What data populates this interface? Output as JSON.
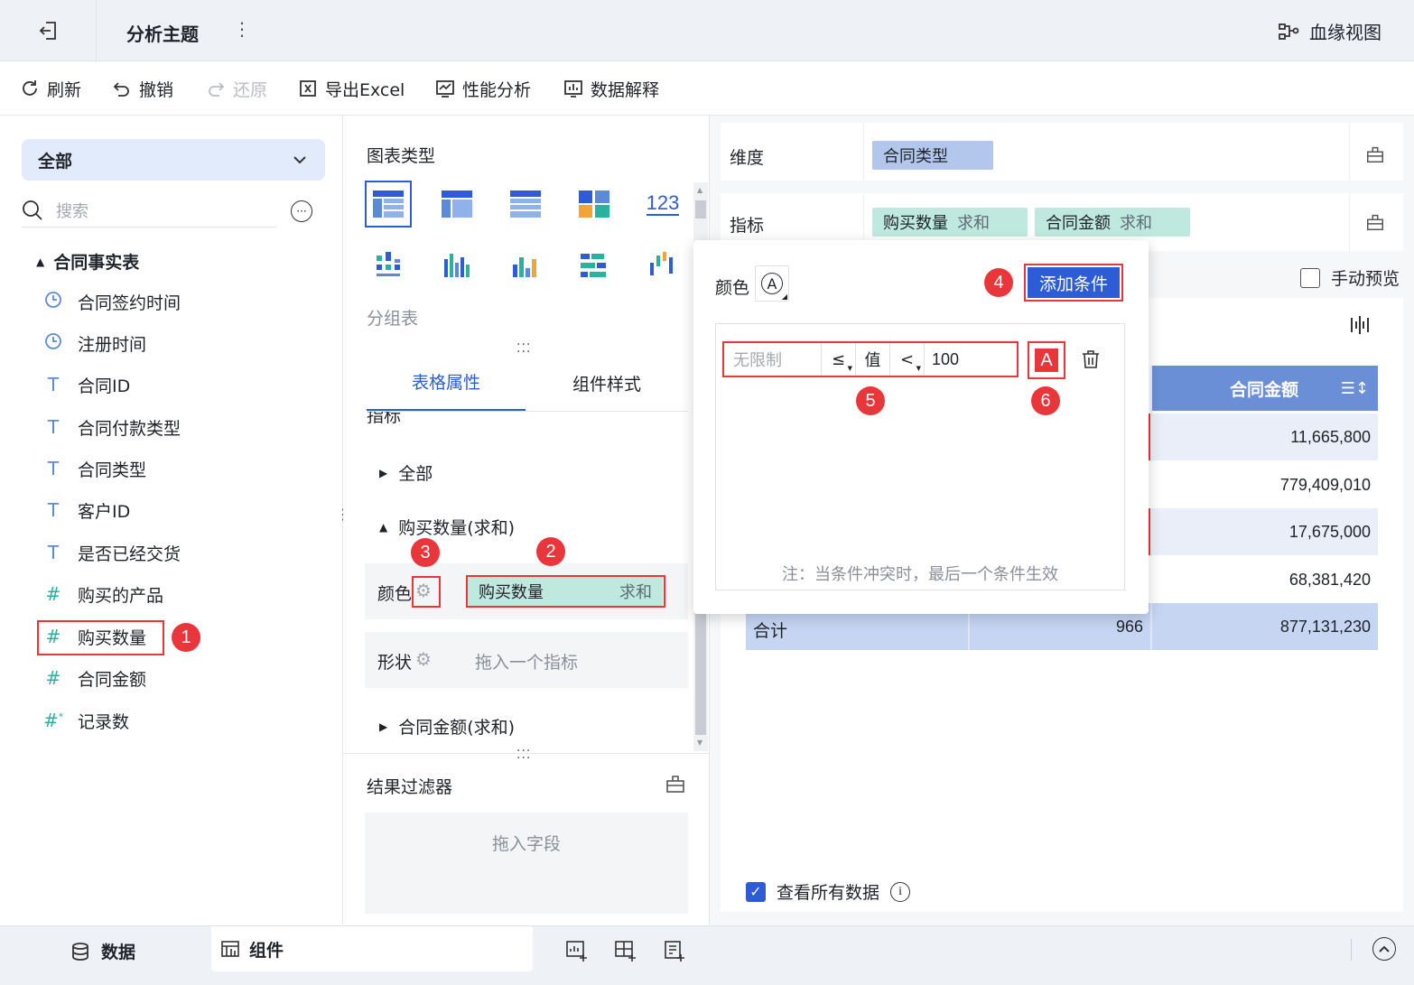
{
  "topbar": {
    "title": "分析主题",
    "lineage": "血缘视图"
  },
  "toolbar": {
    "refresh": "刷新",
    "undo": "撤销",
    "redo": "还原",
    "export": "导出Excel",
    "perf": "性能分析",
    "explain": "数据解释"
  },
  "left": {
    "scope": "全部",
    "search_placeholder": "搜索",
    "table_name": "合同事实表",
    "fields": [
      {
        "label": "合同签约时间",
        "icon": "clock-icon"
      },
      {
        "label": "注册时间",
        "icon": "clock-icon"
      },
      {
        "label": "合同ID",
        "icon": "text-icon"
      },
      {
        "label": "合同付款类型",
        "icon": "text-icon"
      },
      {
        "label": "合同类型",
        "icon": "text-icon"
      },
      {
        "label": "客户ID",
        "icon": "text-icon"
      },
      {
        "label": "是否已经交货",
        "icon": "text-icon"
      },
      {
        "label": "购买的产品",
        "icon": "number-icon"
      },
      {
        "label": "购买数量",
        "icon": "number-icon"
      },
      {
        "label": "合同金额",
        "icon": "number-icon"
      },
      {
        "label": "记录数",
        "icon": "count-icon"
      }
    ]
  },
  "mid": {
    "chart_type_label": "图表类型",
    "chart_type_selected": "分组表",
    "chart_type_123": "123",
    "tabs": [
      "表格属性",
      "组件样式"
    ],
    "section_partial": "指标",
    "tree": {
      "all": "全部",
      "qty_sum": "购买数量(求和)",
      "amt_sum": "合同金额(求和)"
    },
    "color_label": "颜色",
    "shape_label": "形状",
    "color_chip": {
      "name": "购买数量",
      "agg": "求和"
    },
    "shape_placeholder": "拖入一个指标",
    "result_filter": "结果过滤器",
    "drop_field": "拖入字段"
  },
  "right": {
    "dimension_label": "维度",
    "dimension_chip": "合同类型",
    "measure_label": "指标",
    "measure_chips": [
      {
        "name": "购买数量",
        "agg": "求和"
      },
      {
        "name": "合同金额",
        "agg": "求和"
      }
    ],
    "manual_preview": "手动预览",
    "column_header": "合同金额",
    "values": [
      "11,665,800",
      "779,409,010",
      "17,675,000",
      "68,381,420"
    ],
    "total_label": "合计",
    "total_qty": "966",
    "total_amt": "877,131,230",
    "view_all": "查看所有数据"
  },
  "popup": {
    "color_label": "颜色",
    "add_condition": "添加条件",
    "cond_min_placeholder": "无限制",
    "op1": "≤",
    "value_label": "值",
    "op2": "<",
    "cond_value": "100",
    "font_swatch": "A",
    "note": "注：当条件冲突时，最后一个条件生效",
    "accent": "#2c5cd6"
  },
  "badges": [
    "1",
    "2",
    "3",
    "4",
    "5",
    "6"
  ],
  "bottom": {
    "data_tab": "数据",
    "component_tab": "组件"
  }
}
